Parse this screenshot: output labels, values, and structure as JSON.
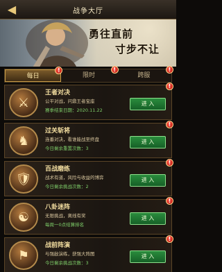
{
  "header": {
    "title": "战争大厅"
  },
  "banner": {
    "slogan_line1": "勇往直前",
    "slogan_line2": "寸步不让"
  },
  "tabs": [
    {
      "label": "每日",
      "active": true,
      "badge": "!"
    },
    {
      "label": "限时",
      "active": false,
      "badge": "!"
    },
    {
      "label": "跨服",
      "active": false,
      "badge": "!"
    }
  ],
  "cards": [
    {
      "name": "王者对决",
      "desc": "公平对战，问鼎王者宝座",
      "meta": "赛季结束日期：2020.11.22",
      "button": "进 入",
      "badge": "!",
      "emblem": "crossed-swords-icon"
    },
    {
      "name": "过关斩将",
      "desc": "连番对决，看谁能战至终盘",
      "meta": "今日剩余重置次数：3",
      "button": "进 入",
      "badge": "!",
      "emblem": "warrior-icon"
    },
    {
      "name": "百战磨练",
      "desc": "战术有道，风险与收益的博弈",
      "meta": "今日剩余挑战次数：2",
      "button": "进 入",
      "badge": "!",
      "emblem": "shield-icon"
    },
    {
      "name": "八卦迷阵",
      "desc": "无限挑战，离线有奖",
      "meta": "每周一0点结算排名",
      "button": "进 入",
      "badge": "!",
      "emblem": "bagua-icon"
    },
    {
      "name": "战前阵演",
      "desc": "与强敌演练，获强大阵图",
      "meta": "今日剩余挑战次数：3",
      "button": "进 入",
      "badge": "!",
      "emblem": "battle-icon"
    }
  ],
  "colors": {
    "accent_gold": "#c79b45",
    "enter_green": "#2a8c3d",
    "badge_red": "#b10d08"
  }
}
